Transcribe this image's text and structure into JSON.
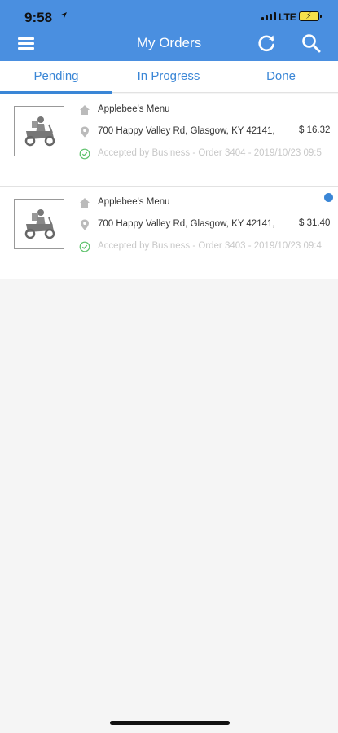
{
  "status_bar": {
    "time": "9:58",
    "network": "LTE"
  },
  "header": {
    "title": "My Orders",
    "menu_icon": "hamburger-icon",
    "refresh_icon": "refresh-icon",
    "search_icon": "search-icon"
  },
  "tabs": [
    {
      "label": "Pending",
      "active": true
    },
    {
      "label": "In Progress",
      "active": false
    },
    {
      "label": "Done",
      "active": false
    }
  ],
  "orders": [
    {
      "business": "Applebee's Menu",
      "address": "700 Happy Valley Rd, Glasgow, KY 42141,",
      "price": "$ 16.32",
      "status": "Accepted by Business - Order 3404 - 2019/10/23 09:5",
      "unread": false
    },
    {
      "business": "Applebee's Menu",
      "address": "700 Happy Valley Rd, Glasgow, KY 42141,",
      "price": "$ 31.40",
      "status": "Accepted by Business - Order 3403 - 2019/10/23 09:4",
      "unread": true
    }
  ],
  "colors": {
    "accent": "#4a8fe0",
    "tab_text": "#3a86d6",
    "status_check": "#5cc16a"
  }
}
